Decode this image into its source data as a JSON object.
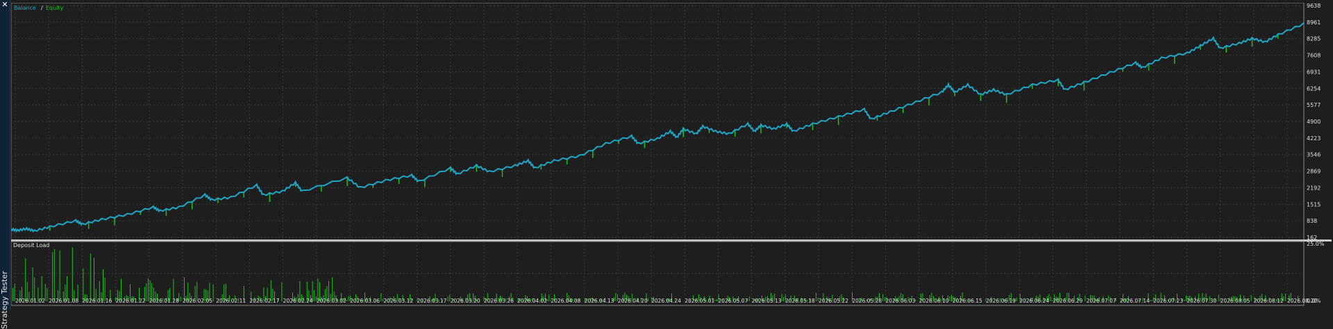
{
  "window": {
    "close_glyph": "✕",
    "panel_title": "Strategy Tester"
  },
  "colors": {
    "background": "#1e1e1e",
    "grid": "#3a3a3a",
    "balance": "#1fa6c7",
    "equity": "#1cc21c",
    "deposit_load": "#19c419",
    "axis_text": "#e0e0e0",
    "separator": "#c8c8c8"
  },
  "legend": {
    "balance_label": "Balance",
    "separator": "/",
    "equity_label": "Equity"
  },
  "deposit_panel": {
    "title": "Deposit Load"
  },
  "chart_data": [
    {
      "type": "line",
      "title": "",
      "series": [
        {
          "name": "Balance",
          "color": "#1fa6c7"
        },
        {
          "name": "Equity",
          "color": "#1cc21c"
        }
      ],
      "x_tick_labels": [
        "2026.01.02",
        "2026.01.08",
        "2026.01.16",
        "2026.01.22",
        "2026.01.28",
        "2026.02.05",
        "2026.02.11",
        "2026.02.17",
        "2026.02.24",
        "2026.03.02",
        "2026.03.06",
        "2026.03.12",
        "2026.03.17",
        "2026.03.20",
        "2026.03.26",
        "2026.04.02",
        "2026.04.08",
        "2026.04.13",
        "2026.04.20",
        "2026.04.24",
        "2026.05.01",
        "2026.05.07",
        "2026.05.13",
        "2026.05.18",
        "2026.05.22",
        "2026.05.28",
        "2026.06.03",
        "2026.06.10",
        "2026.06.15",
        "2026.06.19",
        "2026.06.24",
        "2026.06.29",
        "2026.07.07",
        "2026.07.14",
        "2026.07.23",
        "2026.07.30",
        "2026.08.05",
        "2026.08.12",
        "2026.08.20"
      ],
      "y_tick_labels": [
        "9638",
        "8961",
        "8285",
        "7608",
        "6931",
        "6254",
        "5577",
        "4900",
        "4223",
        "3546",
        "2869",
        "2192",
        "1515",
        "838",
        "162"
      ],
      "ylim": [
        162,
        9638
      ],
      "balance_path": [
        [
          0,
          500
        ],
        [
          0.005,
          450
        ],
        [
          0.012,
          520
        ],
        [
          0.018,
          430
        ],
        [
          0.03,
          600
        ],
        [
          0.05,
          850
        ],
        [
          0.055,
          700
        ],
        [
          0.07,
          900
        ],
        [
          0.09,
          1100
        ],
        [
          0.11,
          1400
        ],
        [
          0.115,
          1250
        ],
        [
          0.13,
          1400
        ],
        [
          0.15,
          1900
        ],
        [
          0.155,
          1700
        ],
        [
          0.17,
          1800
        ],
        [
          0.19,
          2300
        ],
        [
          0.195,
          1900
        ],
        [
          0.21,
          2050
        ],
        [
          0.22,
          2400
        ],
        [
          0.225,
          2050
        ],
        [
          0.26,
          2600
        ],
        [
          0.27,
          2200
        ],
        [
          0.29,
          2500
        ],
        [
          0.31,
          2700
        ],
        [
          0.315,
          2450
        ],
        [
          0.34,
          3000
        ],
        [
          0.345,
          2750
        ],
        [
          0.36,
          3100
        ],
        [
          0.37,
          2850
        ],
        [
          0.39,
          3100
        ],
        [
          0.4,
          3300
        ],
        [
          0.405,
          3000
        ],
        [
          0.42,
          3300
        ],
        [
          0.44,
          3500
        ],
        [
          0.46,
          4000
        ],
        [
          0.48,
          4300
        ],
        [
          0.485,
          4000
        ],
        [
          0.5,
          4200
        ],
        [
          0.51,
          4500
        ],
        [
          0.515,
          4250
        ],
        [
          0.52,
          4600
        ],
        [
          0.53,
          4400
        ],
        [
          0.535,
          4700
        ],
        [
          0.545,
          4500
        ],
        [
          0.555,
          4400
        ],
        [
          0.57,
          4800
        ],
        [
          0.575,
          4500
        ],
        [
          0.58,
          4750
        ],
        [
          0.59,
          4600
        ],
        [
          0.6,
          4800
        ],
        [
          0.605,
          4500
        ],
        [
          0.62,
          4800
        ],
        [
          0.64,
          5100
        ],
        [
          0.66,
          5400
        ],
        [
          0.665,
          5000
        ],
        [
          0.68,
          5300
        ],
        [
          0.7,
          5700
        ],
        [
          0.72,
          6100
        ],
        [
          0.725,
          6400
        ],
        [
          0.73,
          6100
        ],
        [
          0.74,
          6400
        ],
        [
          0.75,
          6000
        ],
        [
          0.76,
          6200
        ],
        [
          0.77,
          6000
        ],
        [
          0.79,
          6400
        ],
        [
          0.81,
          6600
        ],
        [
          0.815,
          6200
        ],
        [
          0.83,
          6500
        ],
        [
          0.85,
          6900
        ],
        [
          0.87,
          7300
        ],
        [
          0.875,
          7100
        ],
        [
          0.89,
          7500
        ],
        [
          0.91,
          7700
        ],
        [
          0.92,
          8000
        ],
        [
          0.93,
          8300
        ],
        [
          0.935,
          7900
        ],
        [
          0.95,
          8100
        ],
        [
          0.96,
          8300
        ],
        [
          0.97,
          8150
        ],
        [
          0.98,
          8450
        ],
        [
          1.0,
          8900
        ]
      ],
      "equity_dips": [
        0.03,
        0.06,
        0.08,
        0.1,
        0.12,
        0.14,
        0.16,
        0.18,
        0.2,
        0.22,
        0.24,
        0.26,
        0.28,
        0.3,
        0.32,
        0.34,
        0.36,
        0.38,
        0.41,
        0.43,
        0.45,
        0.47,
        0.49,
        0.52,
        0.54,
        0.56,
        0.58,
        0.6,
        0.62,
        0.64,
        0.67,
        0.69,
        0.71,
        0.73,
        0.75,
        0.77,
        0.79,
        0.81,
        0.83,
        0.86,
        0.88,
        0.9,
        0.92,
        0.94,
        0.96,
        0.98
      ]
    },
    {
      "type": "bar",
      "title": "Deposit Load",
      "y_tick_labels": [
        "25.0%",
        "0.0%"
      ],
      "ylim": [
        0,
        25
      ]
    }
  ]
}
